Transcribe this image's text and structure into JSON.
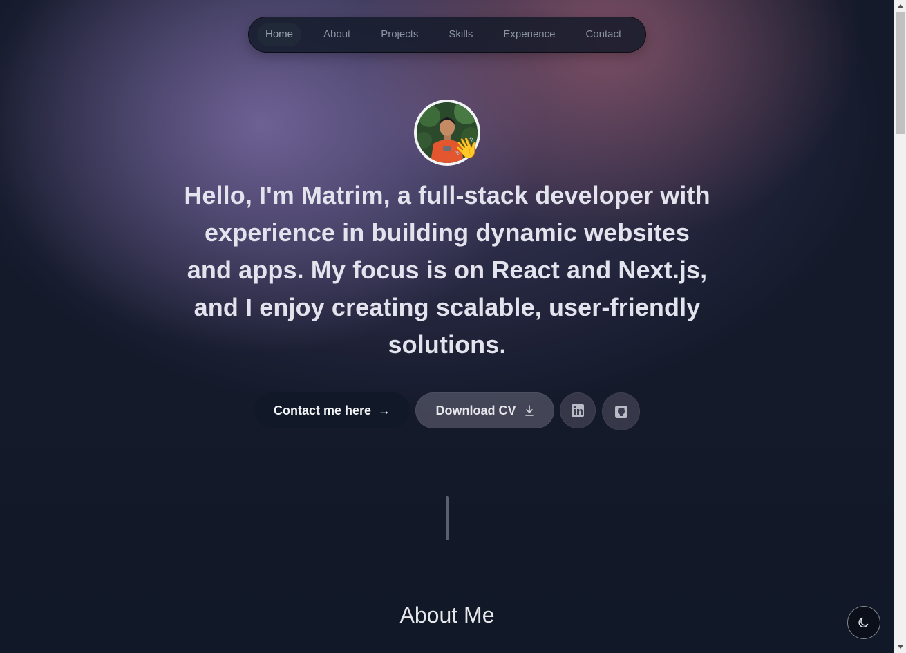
{
  "nav": {
    "items": [
      {
        "label": "Home",
        "active": true
      },
      {
        "label": "About",
        "active": false
      },
      {
        "label": "Projects",
        "active": false
      },
      {
        "label": "Skills",
        "active": false
      },
      {
        "label": "Experience",
        "active": false
      },
      {
        "label": "Contact",
        "active": false
      }
    ]
  },
  "hero": {
    "avatar_badge": "👋",
    "segments": [
      {
        "text": "Hello, I'm Matrim",
        "bold": true
      },
      {
        "text": ", a ",
        "bold": false
      },
      {
        "text": "full-stack developer",
        "bold": true
      },
      {
        "text": " with experience in building dynamic websites and apps. My focus is on ",
        "bold": false
      },
      {
        "text": "React and Next.js",
        "bold": true
      },
      {
        "text": ", and I enjoy creating ",
        "bold": false
      },
      {
        "text": "scalable",
        "bold": true
      },
      {
        "text": ", ",
        "bold": false
      },
      {
        "text": "user-friendly solutions",
        "bold": true
      },
      {
        "text": ".",
        "bold": false
      }
    ]
  },
  "actions": {
    "contact_label": "Contact me here",
    "contact_arrow": "→",
    "cv_label": "Download CV",
    "linkedin_icon": "linkedin-icon",
    "github_icon": "github-icon"
  },
  "about": {
    "title": "About Me"
  },
  "theme_toggle": {
    "icon": "moon-icon"
  },
  "colors": {
    "page_bg": "#111827",
    "button_dark": "#111827",
    "nav_text": "#8b93a3",
    "hero_text": "#e2e3ec"
  }
}
